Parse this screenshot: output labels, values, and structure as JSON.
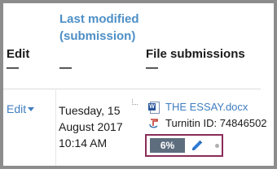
{
  "headers": {
    "edit": "Edit",
    "last_modified": "Last modified (submission)",
    "file_submissions": "File submissions",
    "sort_marker": "—"
  },
  "row": {
    "edit_link": "Edit",
    "date": "Tuesday, 15 August 2017 10:14 AM",
    "file_name": "THE ESSAY.docx",
    "turnitin_id": "Turnitin ID: 74846502",
    "similarity": "6%"
  },
  "icons": {
    "file": "word-doc-icon",
    "turnitin": "turnitin-icon",
    "edit_grade": "pencil-icon",
    "more": "dot-icon",
    "dropdown": "caret-down-icon"
  },
  "colors": {
    "link": "#3f7ec0",
    "header_accent": "#4d8fc6",
    "badge_bg": "#5e6d7e",
    "highlight_border": "#8a2c58",
    "pencil": "#2e7bd6"
  }
}
